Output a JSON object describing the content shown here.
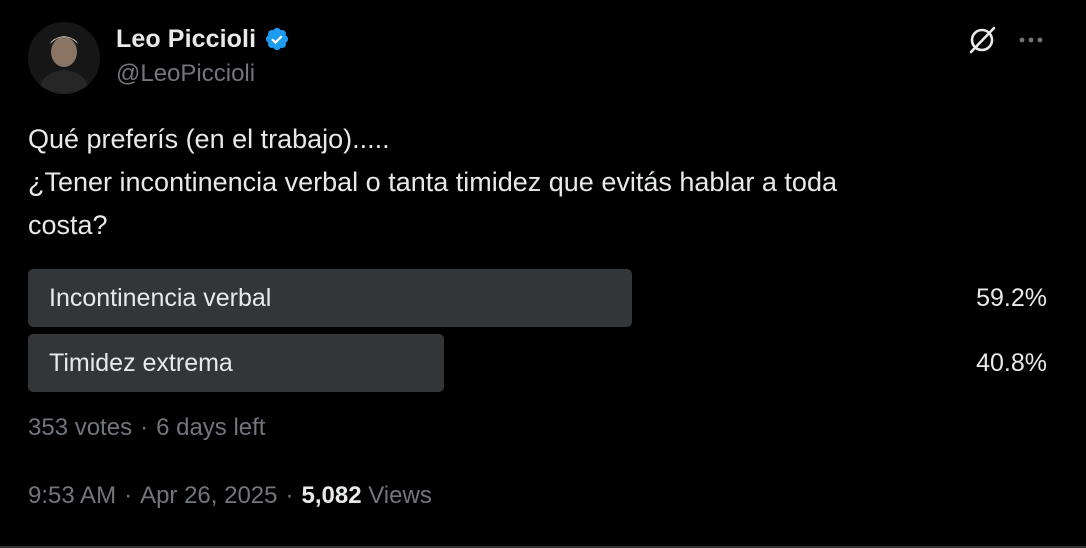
{
  "author": {
    "display_name": "Leo Piccioli",
    "handle": "@LeoPiccioli",
    "verified": true,
    "verified_color": "#1d9bf0"
  },
  "tweet": {
    "lines": [
      "Qué preferís (en el trabajo).....",
      "¿Tener incontinencia verbal o tanta timidez que evitás hablar a toda",
      "costa?"
    ]
  },
  "poll": {
    "options": [
      {
        "label": "Incontinencia verbal",
        "percent_text": "59.2%",
        "percent": 59.2
      },
      {
        "label": "Timidez extrema",
        "percent_text": "40.8%",
        "percent": 40.8
      }
    ],
    "votes": "353 votes",
    "separator": "·",
    "time_left": "6 days left"
  },
  "meta": {
    "time": "9:53 AM",
    "separator": "·",
    "date": "Apr 26, 2025",
    "views_count": "5,082",
    "views_label": "Views"
  },
  "icons": {
    "verified": "verified-badge-icon",
    "grok": "grok-icon",
    "more": "more-options-icon"
  },
  "colors": {
    "background": "#000000",
    "text": "#e7e9ea",
    "secondary_text": "#71767b",
    "poll_bar": "#333639"
  }
}
